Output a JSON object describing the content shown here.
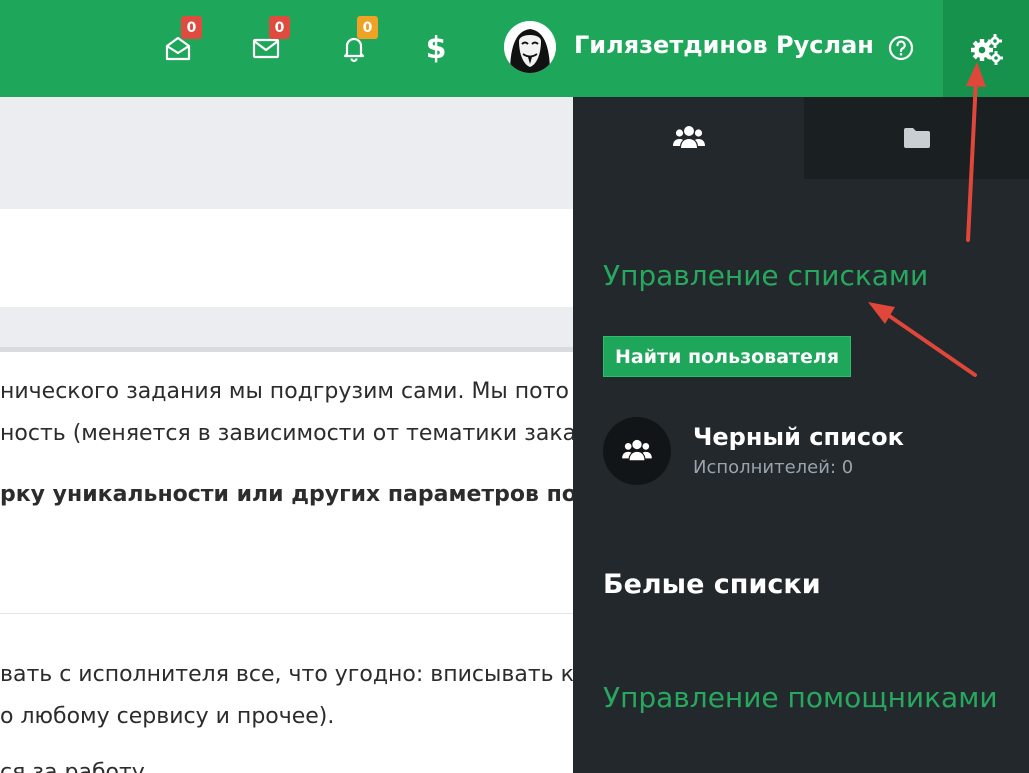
{
  "header": {
    "badges": {
      "inbox": "0",
      "mail": "0",
      "notifications": "0"
    },
    "dollar": "$",
    "username": "Гилязетдинов Руслан",
    "icons": [
      "inbox-icon",
      "mail-icon",
      "bell-icon",
      "dollar-icon",
      "avatar",
      "help-icon",
      "gears-icon"
    ]
  },
  "content": {
    "lines": [
      "нического задания мы подгрузим сами. Мы пото",
      "ность (меняется в зависимости от тематики зака",
      "рку уникальности или других параметров по ва",
      "вать с исполнителя все, что угодно: вписывать к",
      "о любому сервису и прочее).",
      "ся за работу"
    ]
  },
  "panel": {
    "tabs": [
      {
        "icon": "users-icon",
        "active": true
      },
      {
        "icon": "folder-icon",
        "active": false
      }
    ],
    "manage_lists_title": "Управление списками",
    "find_user_button": "Найти пользователя",
    "blacklist": {
      "name": "Черный список",
      "count": "Исполнителей: 0",
      "icon": "users-icon"
    },
    "white_lists": "Белые списки",
    "manage_helpers_title": "Управление помощниками"
  },
  "colors": {
    "brand_green": "#1ea65a",
    "panel_bg": "#22282c",
    "title_green": "#27a85e",
    "badge_red": "#e04b3f",
    "badge_orange": "#f0a227",
    "annotation_arrow": "#e0463a"
  }
}
